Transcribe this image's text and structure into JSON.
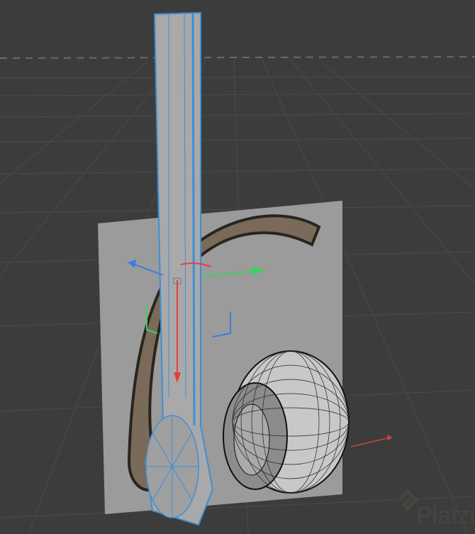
{
  "watermark": {
    "text": "Platzi"
  },
  "colors": {
    "background": "#3c3c3c",
    "grid": "#4a4a4a",
    "plane": "#9a9a9a",
    "selection": "#3d8fd6",
    "axis_x": "#e04040",
    "axis_y": "#3fd05a",
    "axis_z": "#3b7de0"
  }
}
